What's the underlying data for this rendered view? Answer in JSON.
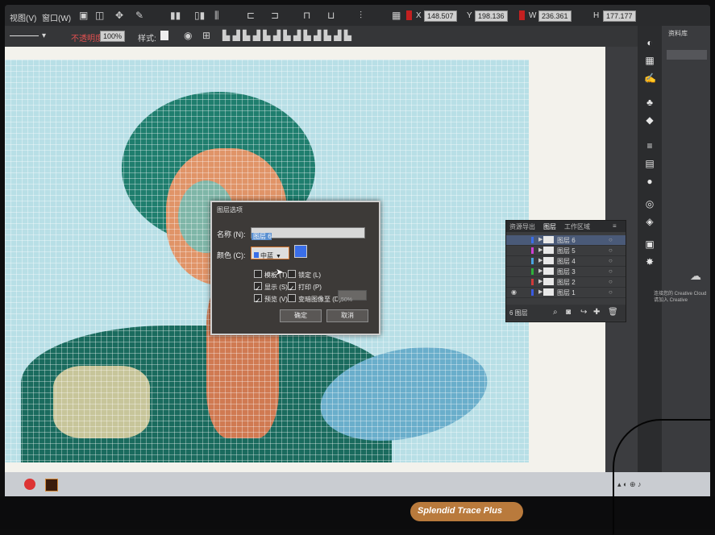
{
  "menubar": {
    "items": [
      "视图(V)",
      "窗口(W)"
    ],
    "icons": [
      "layout-icon",
      "arrange-icon",
      "bridge-icon",
      "stock-icon"
    ],
    "fields": {
      "x": "148.507",
      "y": "198.136",
      "w": "236.361",
      "h": "177.177"
    }
  },
  "ctrlbar": {
    "opacity_label": "不透明度:",
    "opacity_value": "100%",
    "style_label": "样式:"
  },
  "dialog": {
    "title": "图层选项",
    "name_label": "名称 (N):",
    "name_value": "图层 6",
    "color_label": "颜色 (C):",
    "color_value": "中蓝",
    "color_swatch": "#3a6ee8",
    "template_label": "模板 (T)",
    "lock_label": "锁定 (L)",
    "show_label": "显示 (S)",
    "print_label": "打印 (P)",
    "preview_label": "预览 (V)",
    "dim_label": "变暗图像至 (D):",
    "dim_value": "50%",
    "ok_label": "确定",
    "cancel_label": "取消",
    "checks": {
      "template": false,
      "lock": false,
      "show": true,
      "print": true,
      "preview": true,
      "dim": false
    }
  },
  "layers": {
    "tabs": [
      "资源导出",
      "图层",
      "工作区域"
    ],
    "rows": [
      {
        "name": "图层 6",
        "color": "#3a6ee8"
      },
      {
        "name": "图层 5",
        "color": "#cf3fd0"
      },
      {
        "name": "图层 4",
        "color": "#4aa3e0"
      },
      {
        "name": "图层 3",
        "color": "#2db13a"
      },
      {
        "name": "图层 2",
        "color": "#d03a3a"
      },
      {
        "name": "图层 1",
        "color": "#3a5be0"
      }
    ],
    "footer": "6 图层"
  },
  "library": {
    "title": "资料库",
    "cc_message": "连接您的 Creative Cloud 请加入 Creative"
  },
  "brand": "Splendid Trace Plus"
}
